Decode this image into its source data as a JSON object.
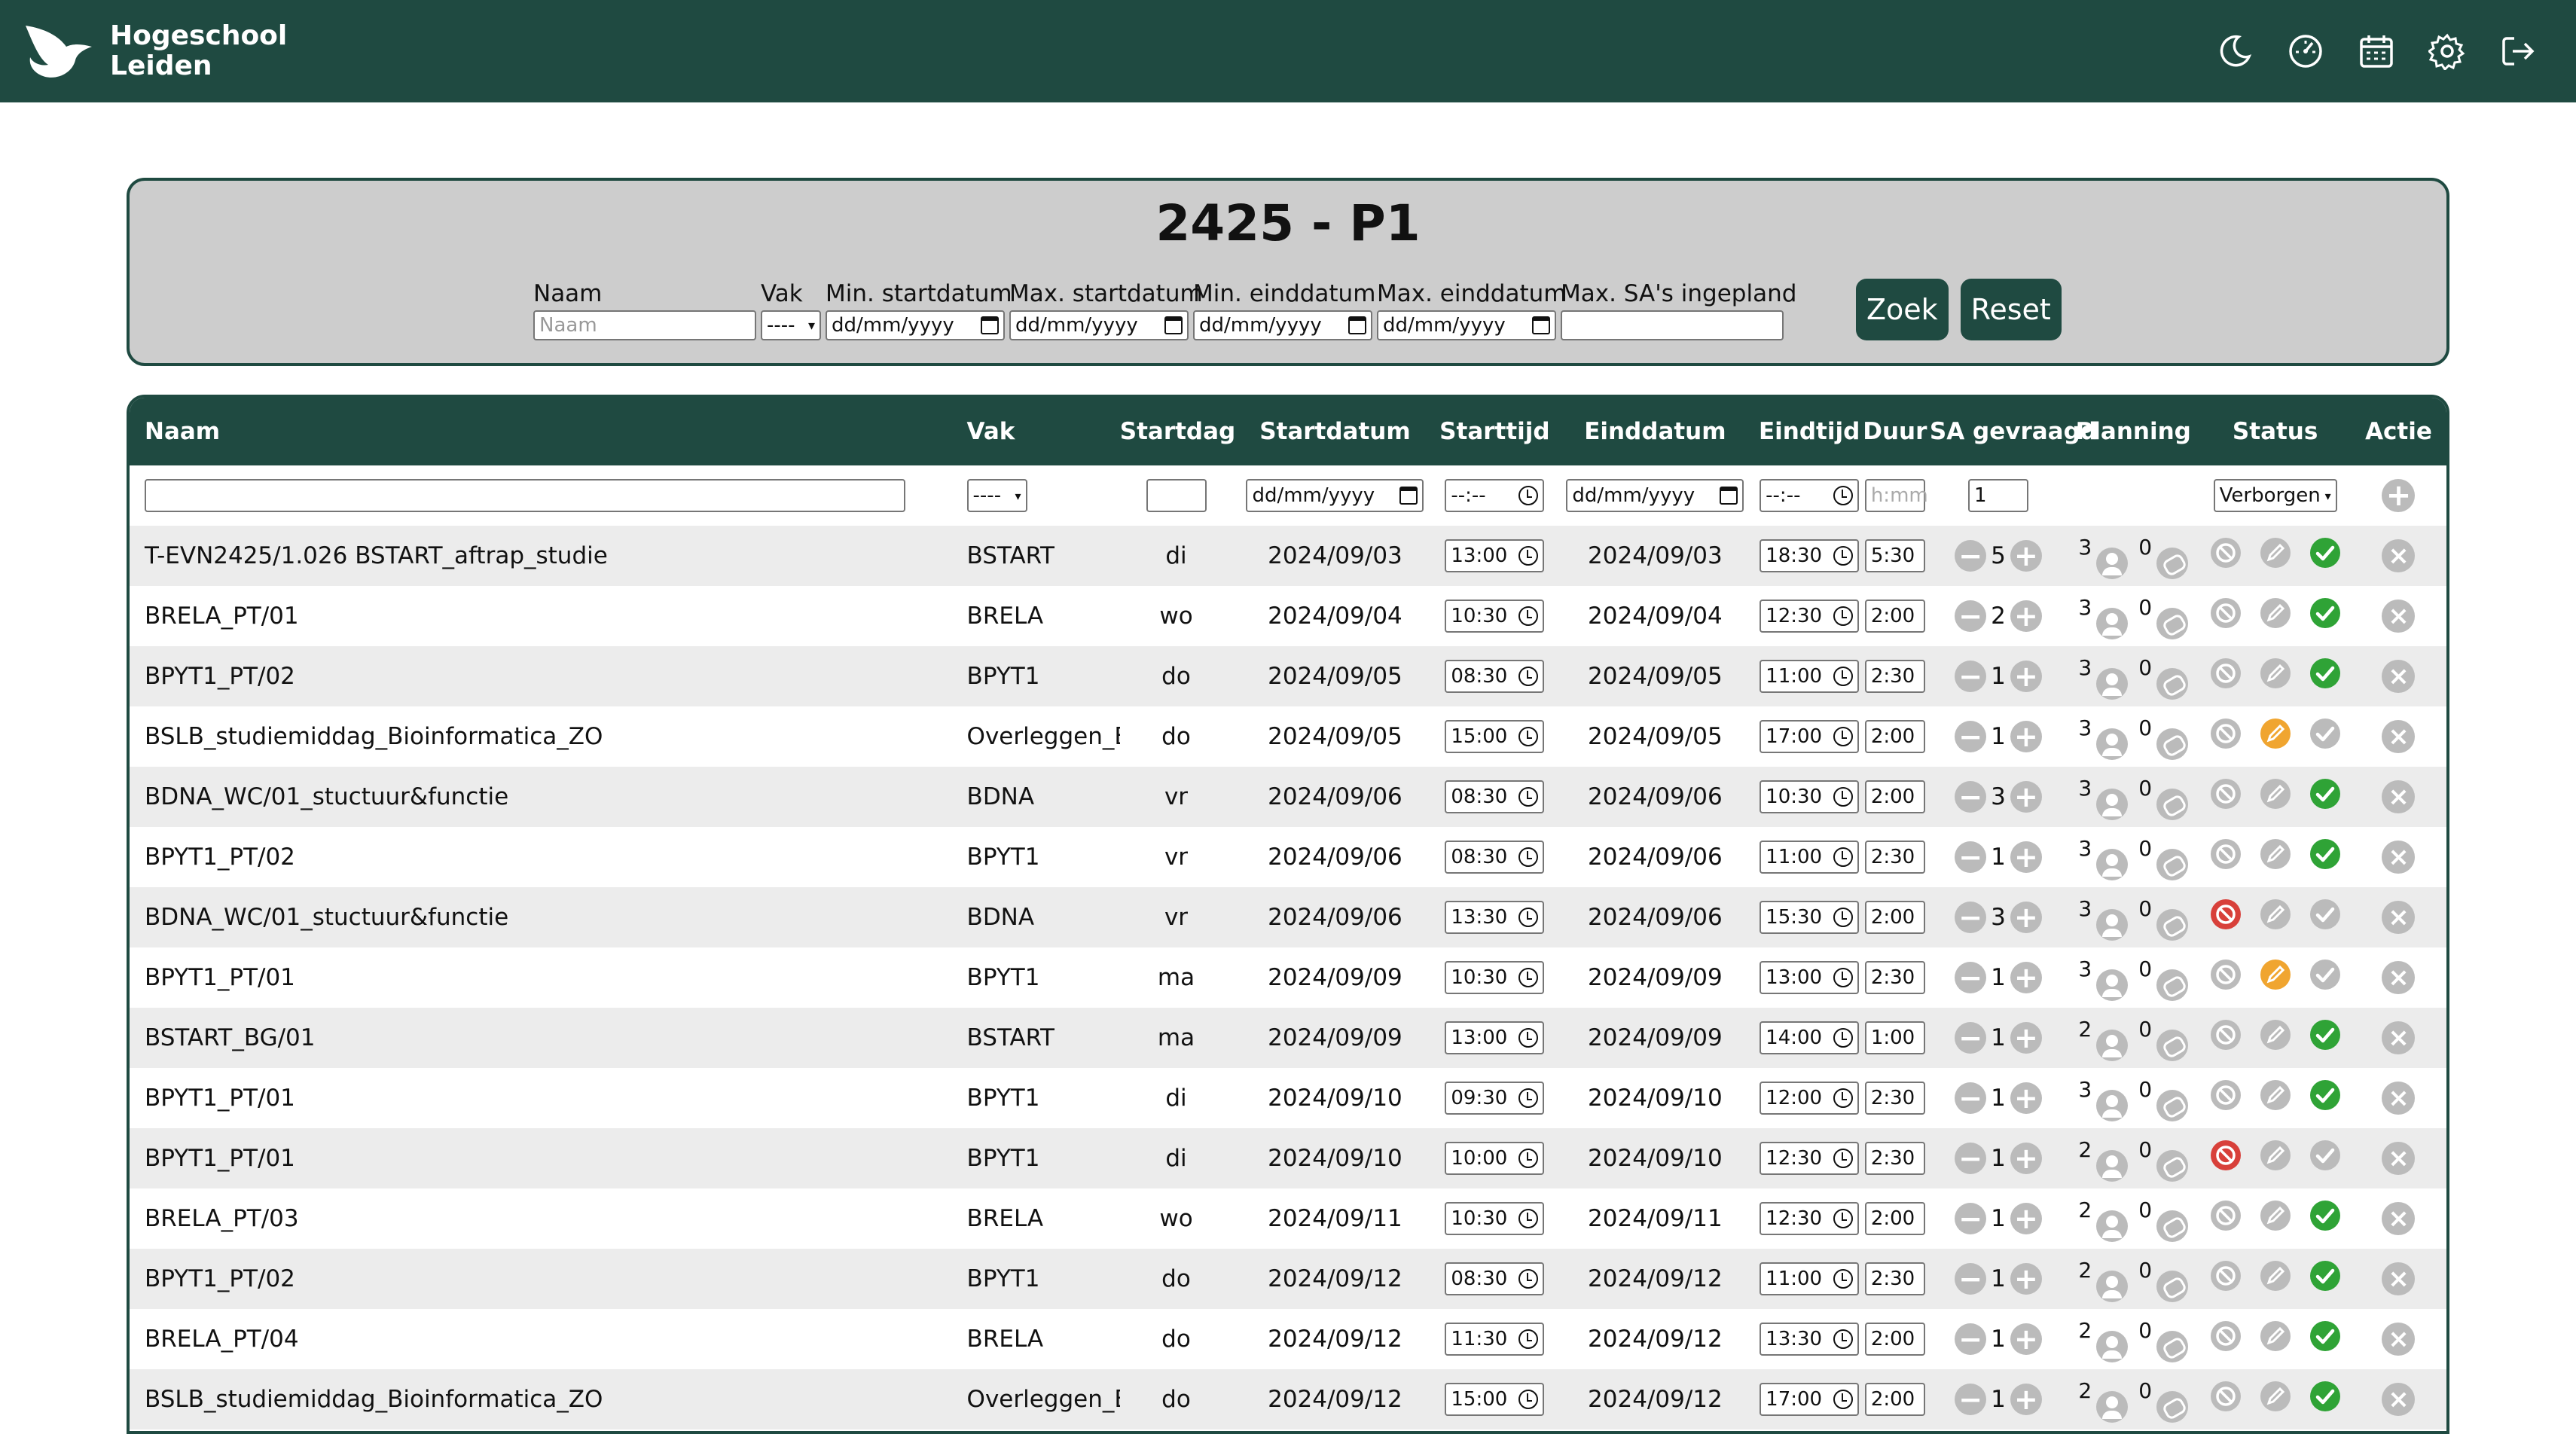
{
  "brand": {
    "line1": "Hogeschool",
    "line2": "Leiden"
  },
  "nav_icons": [
    "moon-icon",
    "dashboard-icon",
    "calendar-icon",
    "settings-icon",
    "logout-icon"
  ],
  "page_title": "2425 - P1",
  "filters": {
    "naam_label": "Naam",
    "naam_placeholder": "Naam",
    "vak_label": "Vak",
    "vak_value": "----",
    "min_start_label": "Min. startdatum",
    "max_start_label": "Max. startdatum",
    "min_eind_label": "Min. einddatum",
    "max_eind_label": "Max. einddatum",
    "max_sa_label": "Max. SA's ingepland",
    "date_placeholder": "dd/mm/yyyy",
    "zoek_label": "Zoek",
    "reset_label": "Reset"
  },
  "table": {
    "headers": {
      "naam": "Naam",
      "vak": "Vak",
      "startdag": "Startdag",
      "startdatum": "Startdatum",
      "starttijd": "Starttijd",
      "einddatum": "Einddatum",
      "eindtijd": "Eindtijd",
      "duur": "Duur",
      "sa": "SA gevraagd",
      "planning": "Planning",
      "status": "Status",
      "actie": "Actie"
    },
    "new_row": {
      "vak": "----",
      "date": "dd/mm/yyyy",
      "time": "--:--",
      "duur_placeholder": "h:mm",
      "sa": "1",
      "status": "Verborgen"
    },
    "rows": [
      {
        "naam": "T-EVN2425/1.026 BSTART_aftrap_studie",
        "vak": "BSTART",
        "dag": "di",
        "start": "2024/09/03",
        "st": "13:00",
        "eind": "2024/09/03",
        "et": "18:30",
        "duur": "5:30",
        "sa": "5",
        "p1": "3",
        "p2": "0",
        "state": "ok"
      },
      {
        "naam": "BRELA_PT/01",
        "vak": "BRELA",
        "dag": "wo",
        "start": "2024/09/04",
        "st": "10:30",
        "eind": "2024/09/04",
        "et": "12:30",
        "duur": "2:00",
        "sa": "2",
        "p1": "3",
        "p2": "0",
        "state": "ok"
      },
      {
        "naam": "BPYT1_PT/02",
        "vak": "BPYT1",
        "dag": "do",
        "start": "2024/09/05",
        "st": "08:30",
        "eind": "2024/09/05",
        "et": "11:00",
        "duur": "2:30",
        "sa": "1",
        "p1": "3",
        "p2": "0",
        "state": "ok"
      },
      {
        "naam": "BSLB_studiemiddag_Bioinformatica_ZO",
        "vak": "Overleggen_BI",
        "dag": "do",
        "start": "2024/09/05",
        "st": "15:00",
        "eind": "2024/09/05",
        "et": "17:00",
        "duur": "2:00",
        "sa": "1",
        "p1": "3",
        "p2": "0",
        "state": "edit"
      },
      {
        "naam": "BDNA_WC/01_stuctuur&functie",
        "vak": "BDNA",
        "dag": "vr",
        "start": "2024/09/06",
        "st": "08:30",
        "eind": "2024/09/06",
        "et": "10:30",
        "duur": "2:00",
        "sa": "3",
        "p1": "3",
        "p2": "0",
        "state": "ok"
      },
      {
        "naam": "BPYT1_PT/02",
        "vak": "BPYT1",
        "dag": "vr",
        "start": "2024/09/06",
        "st": "08:30",
        "eind": "2024/09/06",
        "et": "11:00",
        "duur": "2:30",
        "sa": "1",
        "p1": "3",
        "p2": "0",
        "state": "ok"
      },
      {
        "naam": "BDNA_WC/01_stuctuur&functie",
        "vak": "BDNA",
        "dag": "vr",
        "start": "2024/09/06",
        "st": "13:30",
        "eind": "2024/09/06",
        "et": "15:30",
        "duur": "2:00",
        "sa": "3",
        "p1": "3",
        "p2": "0",
        "state": "blocked"
      },
      {
        "naam": "BPYT1_PT/01",
        "vak": "BPYT1",
        "dag": "ma",
        "start": "2024/09/09",
        "st": "10:30",
        "eind": "2024/09/09",
        "et": "13:00",
        "duur": "2:30",
        "sa": "1",
        "p1": "3",
        "p2": "0",
        "state": "edit"
      },
      {
        "naam": "BSTART_BG/01",
        "vak": "BSTART",
        "dag": "ma",
        "start": "2024/09/09",
        "st": "13:00",
        "eind": "2024/09/09",
        "et": "14:00",
        "duur": "1:00",
        "sa": "1",
        "p1": "2",
        "p2": "0",
        "state": "ok"
      },
      {
        "naam": "BPYT1_PT/01",
        "vak": "BPYT1",
        "dag": "di",
        "start": "2024/09/10",
        "st": "09:30",
        "eind": "2024/09/10",
        "et": "12:00",
        "duur": "2:30",
        "sa": "1",
        "p1": "3",
        "p2": "0",
        "state": "ok"
      },
      {
        "naam": "BPYT1_PT/01",
        "vak": "BPYT1",
        "dag": "di",
        "start": "2024/09/10",
        "st": "10:00",
        "eind": "2024/09/10",
        "et": "12:30",
        "duur": "2:30",
        "sa": "1",
        "p1": "2",
        "p2": "0",
        "state": "blocked"
      },
      {
        "naam": "BRELA_PT/03",
        "vak": "BRELA",
        "dag": "wo",
        "start": "2024/09/11",
        "st": "10:30",
        "eind": "2024/09/11",
        "et": "12:30",
        "duur": "2:00",
        "sa": "1",
        "p1": "2",
        "p2": "0",
        "state": "ok"
      },
      {
        "naam": "BPYT1_PT/02",
        "vak": "BPYT1",
        "dag": "do",
        "start": "2024/09/12",
        "st": "08:30",
        "eind": "2024/09/12",
        "et": "11:00",
        "duur": "2:30",
        "sa": "1",
        "p1": "2",
        "p2": "0",
        "state": "ok"
      },
      {
        "naam": "BRELA_PT/04",
        "vak": "BRELA",
        "dag": "do",
        "start": "2024/09/12",
        "st": "11:30",
        "eind": "2024/09/12",
        "et": "13:30",
        "duur": "2:00",
        "sa": "1",
        "p1": "2",
        "p2": "0",
        "state": "ok"
      },
      {
        "naam": "BSLB_studiemiddag_Bioinformatica_ZO",
        "vak": "Overleggen_BI",
        "dag": "do",
        "start": "2024/09/12",
        "st": "15:00",
        "eind": "2024/09/12",
        "et": "17:00",
        "duur": "2:00",
        "sa": "1",
        "p1": "2",
        "p2": "0",
        "state": "ok"
      }
    ]
  },
  "colors": {
    "brand": "#1f4a41",
    "ok": "#2fa336",
    "warn": "#f0a530",
    "danger": "#d8403a",
    "grey": "#bbbbbb"
  }
}
